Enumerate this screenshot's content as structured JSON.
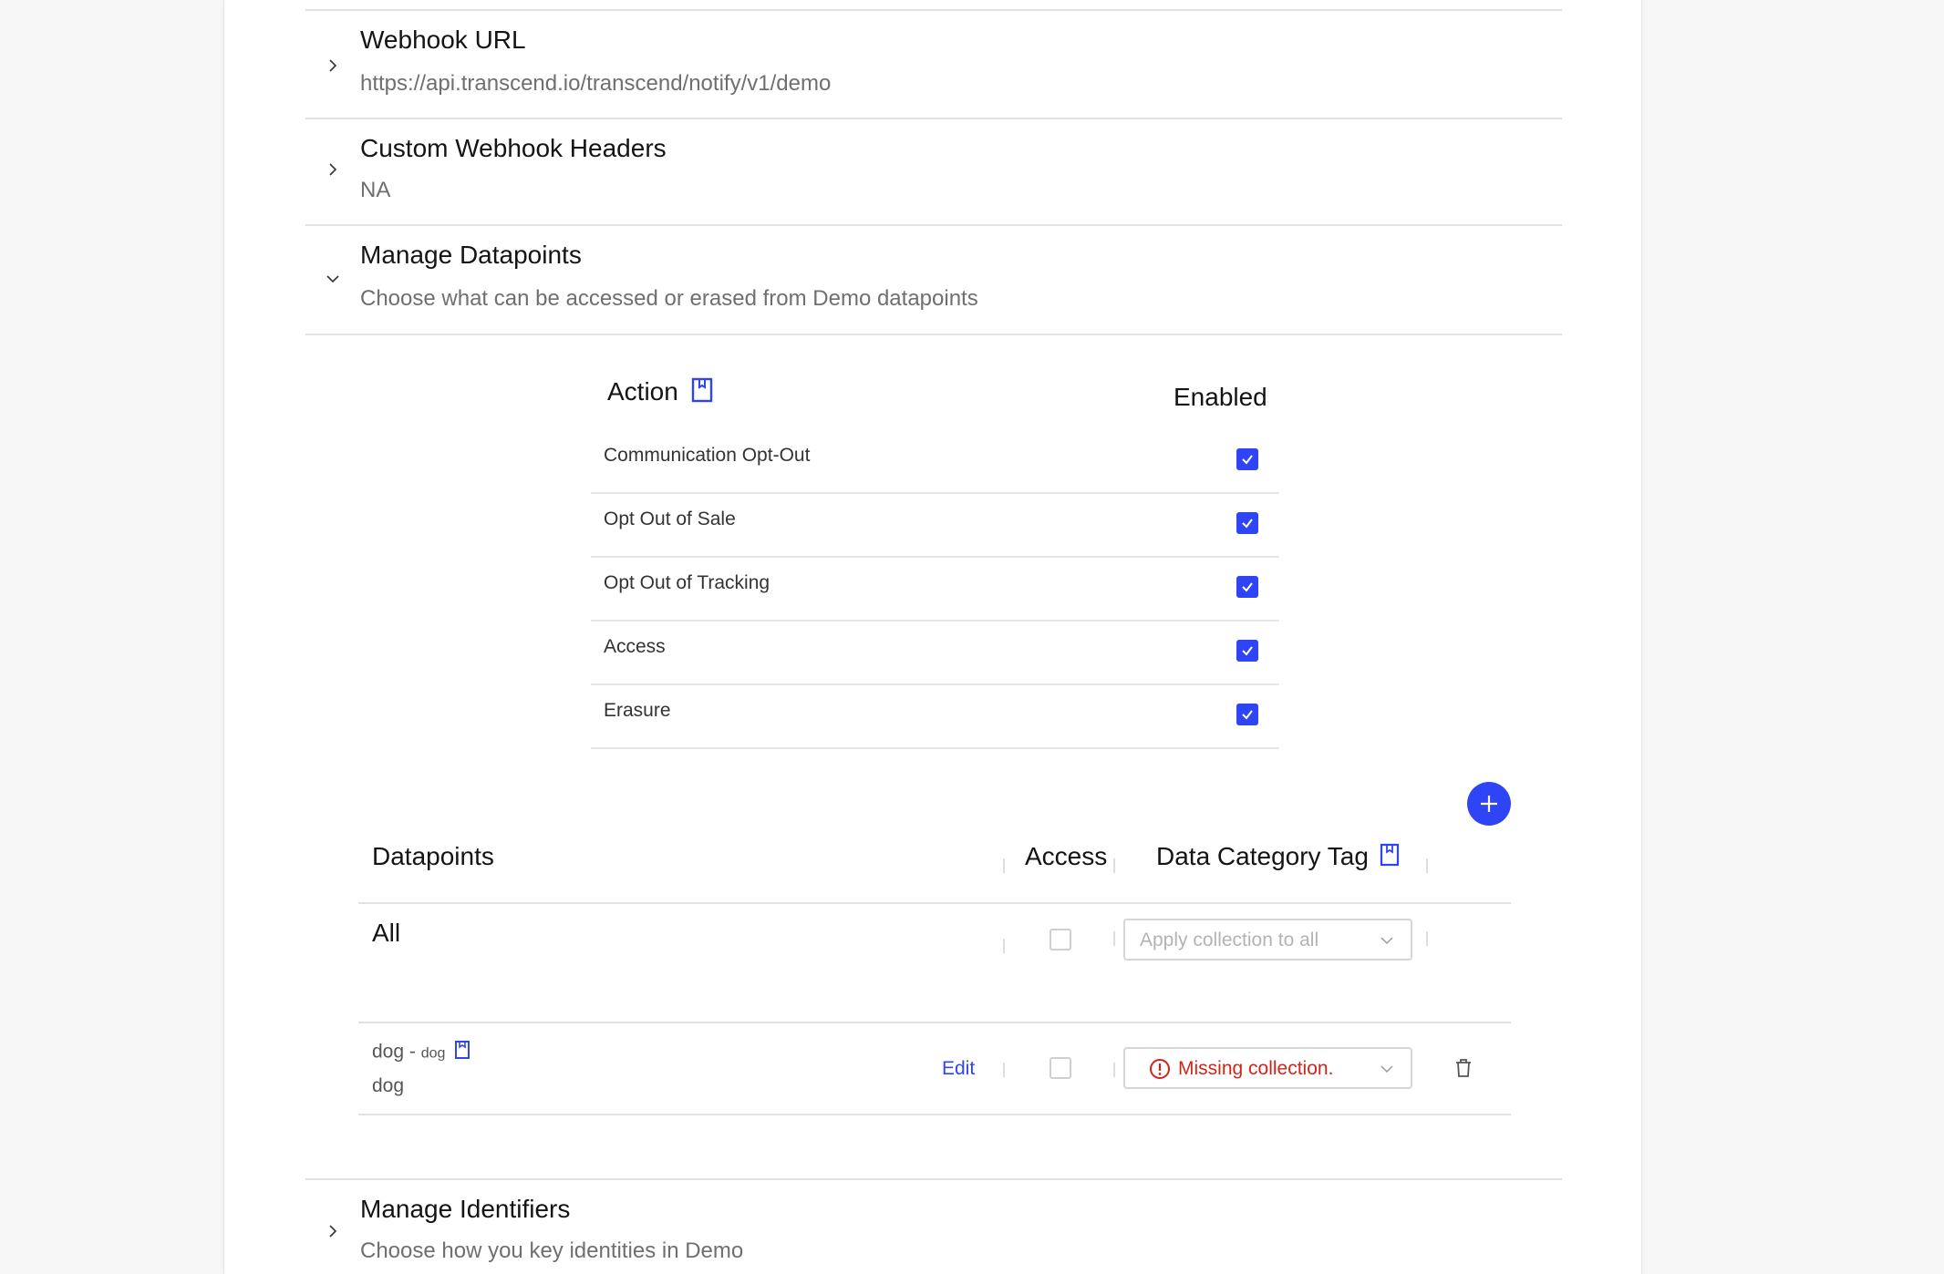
{
  "sections": {
    "webhook_url": {
      "title": "Webhook URL",
      "value": "https://api.transcend.io/transcend/notify/v1/demo"
    },
    "custom_headers": {
      "title": "Custom Webhook Headers",
      "value": "NA"
    },
    "manage_datapoints": {
      "title": "Manage Datapoints",
      "subtitle": "Choose what can be accessed or erased from Demo datapoints"
    },
    "manage_identifiers": {
      "title": "Manage Identifiers",
      "subtitle": "Choose how you key identities in Demo"
    }
  },
  "actions_table": {
    "action_header": "Action",
    "enabled_header": "Enabled",
    "rows": [
      {
        "label": "Communication Opt-Out",
        "enabled": true
      },
      {
        "label": "Opt Out of Sale",
        "enabled": true
      },
      {
        "label": "Opt Out of Tracking",
        "enabled": true
      },
      {
        "label": "Access",
        "enabled": true
      },
      {
        "label": "Erasure",
        "enabled": true
      }
    ]
  },
  "datapoints_table": {
    "headers": {
      "datapoints": "Datapoints",
      "access": "Access",
      "category": "Data Category Tag"
    },
    "all_row": {
      "label": "All",
      "select_placeholder": "Apply collection to all"
    },
    "rows": [
      {
        "name": "dog",
        "separator": " - ",
        "key": "dog",
        "description": "dog",
        "edit_label": "Edit",
        "status": "Missing collection."
      }
    ]
  },
  "colors": {
    "accent": "#2f44f5",
    "error": "#d0251b",
    "muted": "#6f6f6f"
  },
  "icons": [
    "chevron-right-icon",
    "chevron-down-icon",
    "book-icon",
    "check-icon",
    "plus-icon",
    "alert-circle-icon",
    "trash-icon"
  ]
}
